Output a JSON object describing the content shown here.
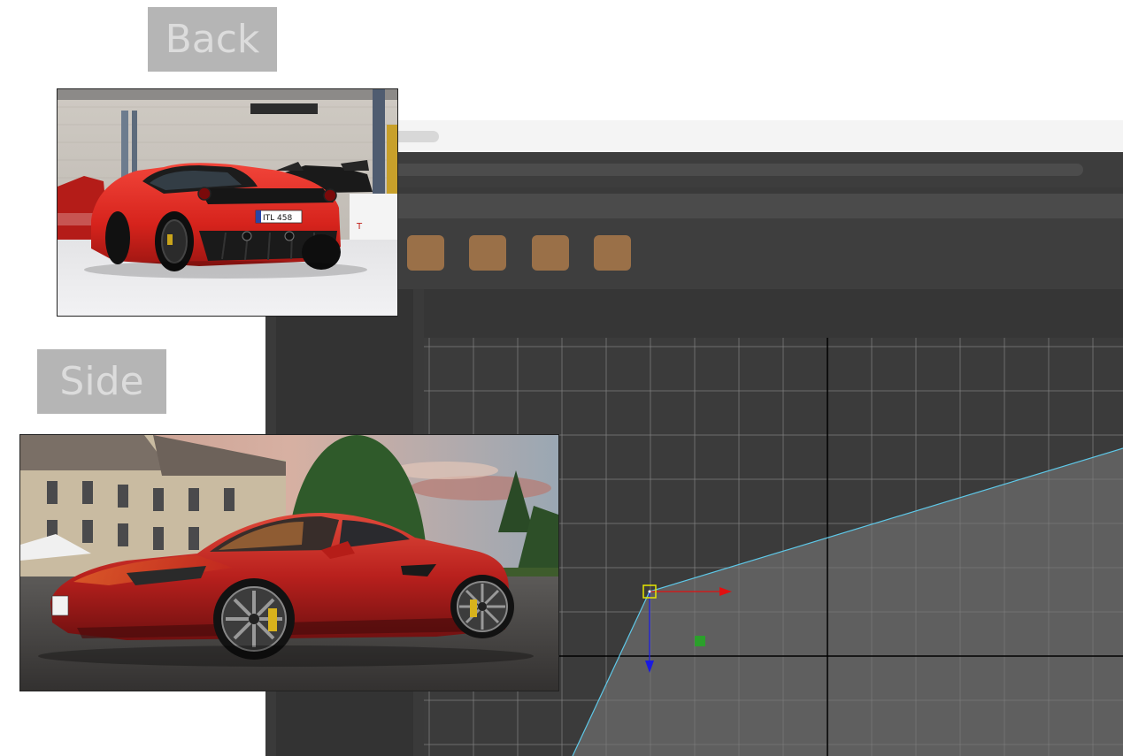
{
  "reference_images": {
    "back": {
      "label": "Back",
      "photo": "red-sports-car-rear-view-in-showroom"
    },
    "side": {
      "label": "Side",
      "photo": "red-sports-car-side-view-in-front-of-chateau"
    }
  },
  "toolbar": {
    "buttons": [
      {
        "name": "tool-button-1",
        "color": "#9a7048"
      },
      {
        "name": "tool-button-2",
        "color": "#9a7048"
      },
      {
        "name": "tool-button-3",
        "color": "#9a7048"
      },
      {
        "name": "tool-button-4",
        "color": "#9a7048"
      }
    ]
  },
  "viewport": {
    "grid_color": "#5a5a5a",
    "axis_color": "#000000",
    "mesh_fill": "#5f5f5f",
    "mesh_edge": "#5ec8e8",
    "selected_vertex_color": "#e8e800",
    "gizmo": {
      "x_axis": "#e01010",
      "y_axis": "#1a1ae0",
      "pivot": "#22aa22"
    },
    "plate_text": "ITL 458"
  }
}
